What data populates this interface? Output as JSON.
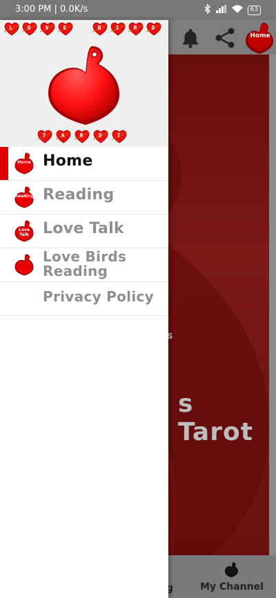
{
  "status_bar": {
    "time": "3:00 PM | 0.0K/s",
    "battery": "63"
  },
  "drawer": {
    "header": {
      "title_letters": [
        "L",
        "O",
        "V",
        "E",
        "B",
        "I",
        "R",
        "D"
      ],
      "subtitle_letters": [
        "T",
        "A",
        "R",
        "O",
        "T"
      ]
    },
    "menu": [
      {
        "label": "Home",
        "icon_label": "Home",
        "active": true
      },
      {
        "label": "Reading",
        "icon_label": "Reading",
        "active": false
      },
      {
        "label": "Love Talk",
        "icon_label": "Love Talk",
        "active": false
      },
      {
        "label": "Love Birds Reading",
        "icon_label": "",
        "active": false
      },
      {
        "label": "Privacy Policy",
        "icon_label": "",
        "active": false
      }
    ]
  },
  "app": {
    "toolbar": {
      "home_badge": "Home"
    },
    "background_title": "s Tarot",
    "background_small": "s",
    "bottom_nav": {
      "left_fragment": "g",
      "my_channel": "My Channel"
    }
  },
  "colors": {
    "accent": "#e00000",
    "heart_red": "#ff1a1a",
    "drawer_header_bg": "#efefef",
    "active_label": "#111111",
    "inactive_label": "#8f8f8f"
  }
}
